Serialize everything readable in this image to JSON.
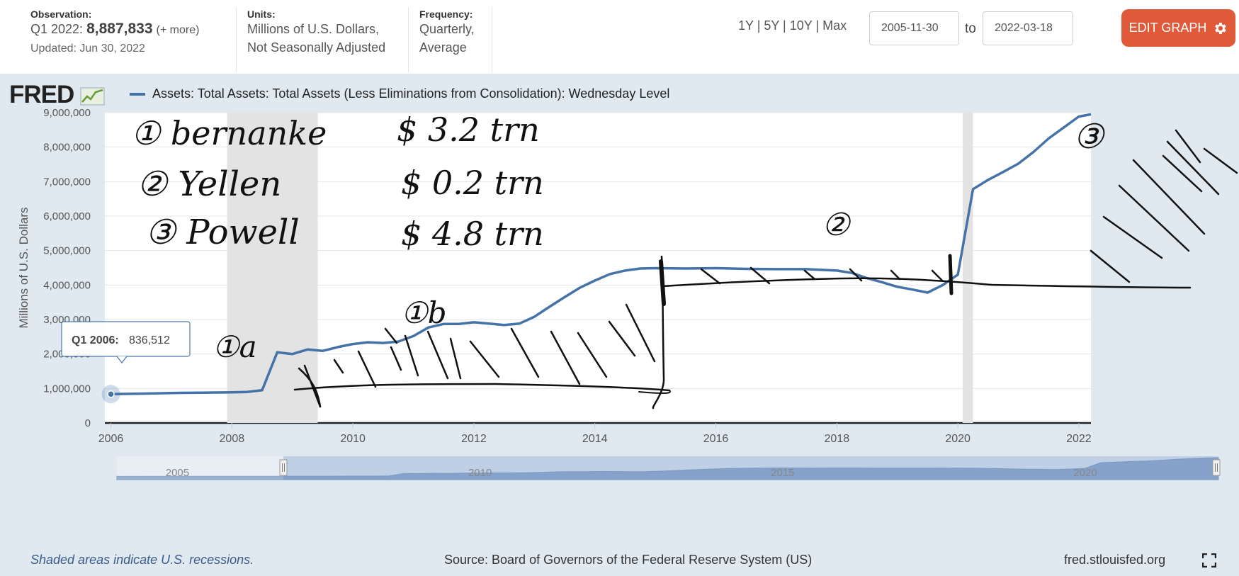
{
  "observation": {
    "label": "Observation:",
    "period": "Q1 2022:",
    "value": "8,887,833",
    "more": "(+ more)",
    "updated": "Updated: Jun 30, 2022"
  },
  "units": {
    "label": "Units:",
    "line1": "Millions of U.S. Dollars,",
    "line2": "Not Seasonally Adjusted"
  },
  "frequency": {
    "label": "Frequency:",
    "line1": "Quarterly,",
    "line2": "Average"
  },
  "range_links": "1Y | 5Y | 10Y | Max",
  "date_from": "2005-11-30",
  "date_to": "2022-03-18",
  "to_label": "to",
  "edit_button": "EDIT GRAPH",
  "logo": "FRED",
  "footer": {
    "shaded_note": "Shaded areas indicate U.S. recessions.",
    "source": "Source: Board of Governors of the Federal Reserve System (US)",
    "site": "fred.stlouisfed.org"
  },
  "tooltip": {
    "period": "Q1 2006:",
    "value": "836,512"
  },
  "colors": {
    "series": "#4572a7",
    "edit_button": "#e05a3a",
    "panel": "#e1e9f0",
    "recession": "#e3e3e3"
  },
  "annotations": [
    "① bernanke",
    "② Yellen",
    "③ Powell",
    "$ 3.2 trn",
    "$ 0.2 trn",
    "$ 4.8 trn",
    "①a",
    "①b",
    "②",
    "③"
  ],
  "chart_data": {
    "type": "line",
    "title": "Assets: Total Assets: Total Assets (Less Eliminations from Consolidation): Wednesday Level",
    "xlabel": "",
    "ylabel": "Millions of U.S. Dollars",
    "xlim": [
      2005.9,
      2022.2
    ],
    "ylim": [
      0,
      9000000
    ],
    "x_ticks": [
      2006,
      2008,
      2010,
      2012,
      2014,
      2016,
      2018,
      2020,
      2022
    ],
    "y_ticks": [
      0,
      1000000,
      2000000,
      3000000,
      4000000,
      5000000,
      6000000,
      7000000,
      8000000,
      9000000
    ],
    "y_tick_labels": [
      "0",
      "1,000,000",
      "2,000,000",
      "3,000,000",
      "4,000,000",
      "5,000,000",
      "6,000,000",
      "7,000,000",
      "8,000,000",
      "9,000,000"
    ],
    "grid": true,
    "recessions": [
      [
        2007.92,
        2009.42
      ],
      [
        2020.08,
        2020.25
      ]
    ],
    "navigator_labels": [
      "2005",
      "2010",
      "2015",
      "2020"
    ],
    "series": [
      {
        "name": "Assets: Total Assets: Total Assets (Less Eliminations from Consolidation): Wednesday Level",
        "x": [
          2006.0,
          2006.5,
          2007.0,
          2007.5,
          2008.0,
          2008.25,
          2008.5,
          2008.75,
          2009.0,
          2009.25,
          2009.5,
          2009.75,
          2010.0,
          2010.25,
          2010.5,
          2010.75,
          2011.0,
          2011.25,
          2011.5,
          2011.75,
          2012.0,
          2012.25,
          2012.5,
          2012.75,
          2013.0,
          2013.25,
          2013.5,
          2013.75,
          2014.0,
          2014.25,
          2014.5,
          2014.75,
          2015.0,
          2015.5,
          2016.0,
          2016.5,
          2017.0,
          2017.5,
          2018.0,
          2018.25,
          2018.5,
          2018.75,
          2019.0,
          2019.25,
          2019.5,
          2019.75,
          2020.0,
          2020.25,
          2020.5,
          2020.75,
          2021.0,
          2021.25,
          2021.5,
          2021.75,
          2022.0,
          2022.2
        ],
        "y": [
          836512,
          850000,
          870000,
          880000,
          890000,
          900000,
          950000,
          2050000,
          2000000,
          2130000,
          2090000,
          2200000,
          2290000,
          2340000,
          2320000,
          2360000,
          2520000,
          2770000,
          2870000,
          2870000,
          2920000,
          2880000,
          2840000,
          2880000,
          3080000,
          3370000,
          3650000,
          3920000,
          4130000,
          4320000,
          4420000,
          4480000,
          4490000,
          4480000,
          4490000,
          4470000,
          4460000,
          4460000,
          4420000,
          4350000,
          4200000,
          4080000,
          3950000,
          3870000,
          3780000,
          4000000,
          4300000,
          6780000,
          7050000,
          7280000,
          7520000,
          7860000,
          8250000,
          8570000,
          8887833,
          8950000
        ]
      }
    ]
  }
}
